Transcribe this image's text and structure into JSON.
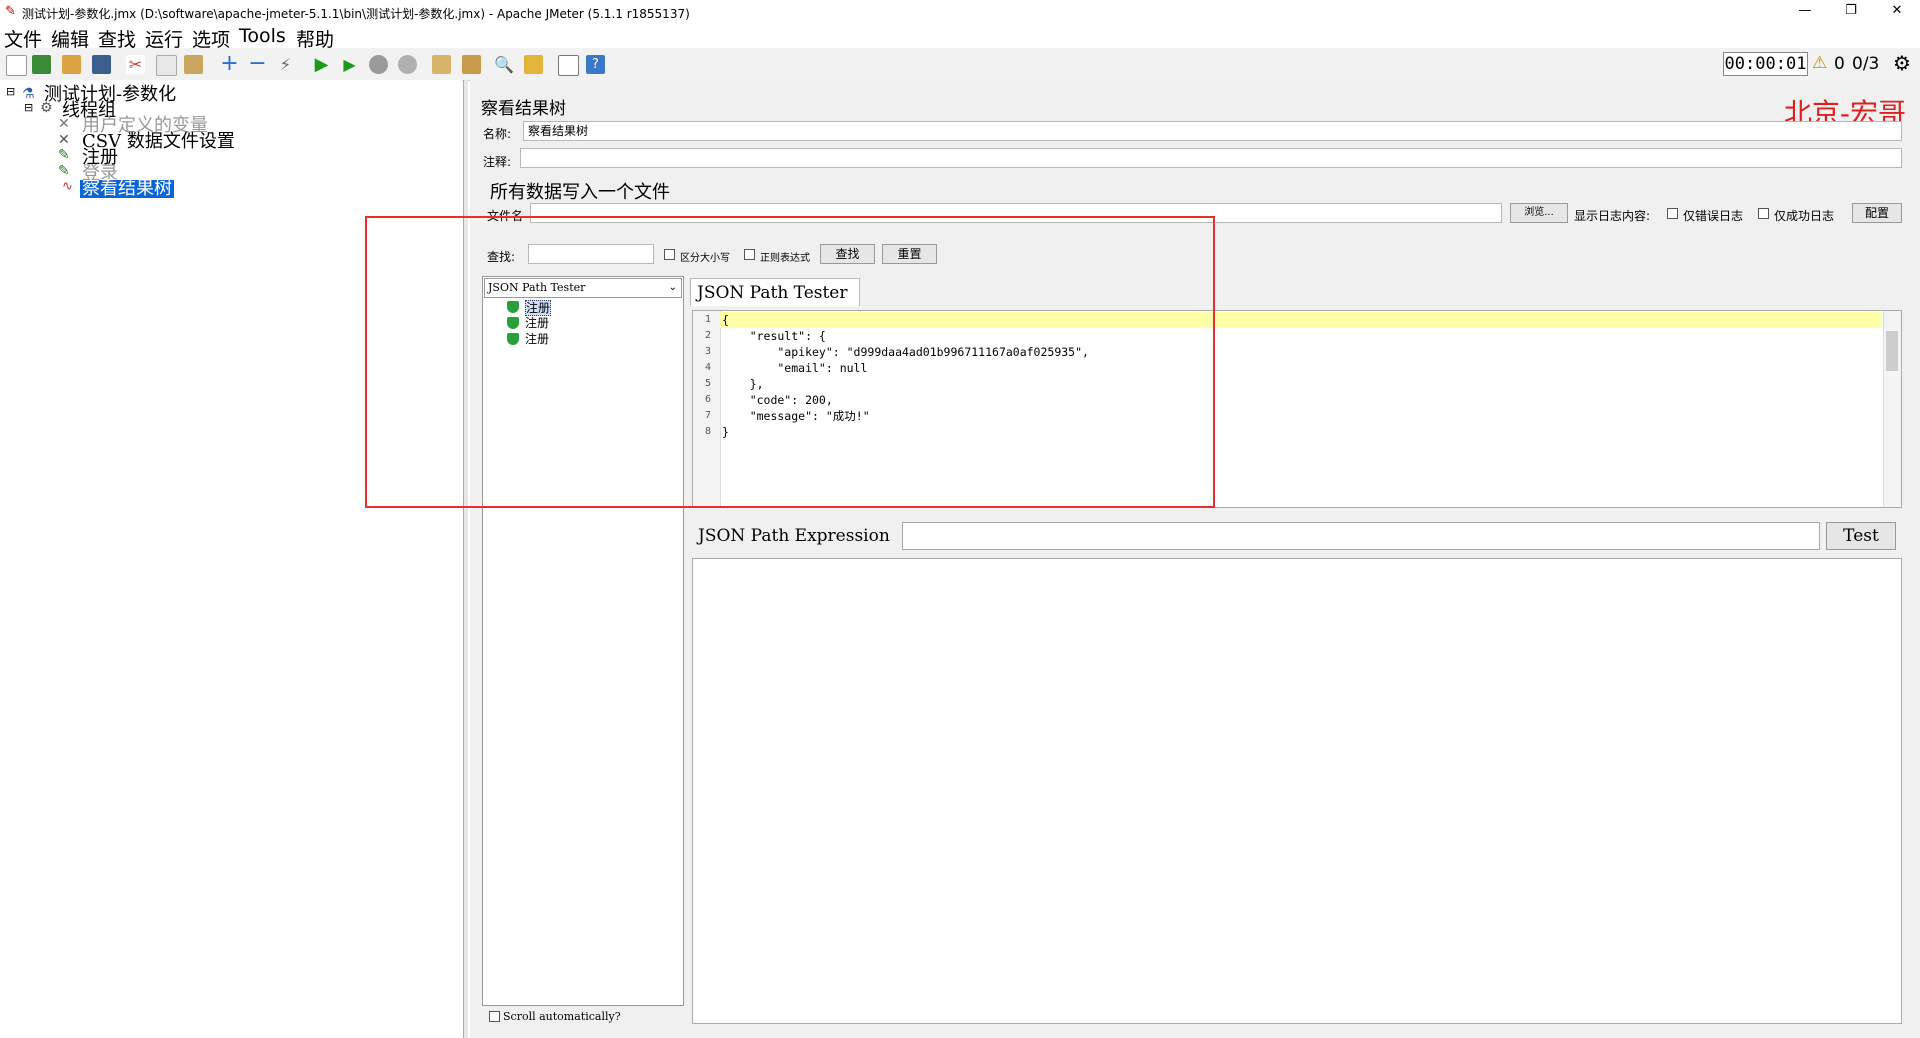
{
  "window": {
    "title": "测试计划-参数化.jmx (D:\\software\\apache-jmeter-5.1.1\\bin\\测试计划-参数化.jmx) - Apache JMeter (5.1.1 r1855137)",
    "min": "—",
    "max": "❐",
    "close": "✕"
  },
  "menu": [
    "文件",
    "编辑",
    "查找",
    "运行",
    "选项",
    "Tools",
    "帮助"
  ],
  "status": {
    "timer": "00:00:01",
    "warnings": "0",
    "threads": "0/3"
  },
  "tree": {
    "root": "测试计划-参数化",
    "thread_group": "线程组",
    "user_vars": "用户定义的变量",
    "csv": "CSV 数据文件设置",
    "register": "注册",
    "login": "登录",
    "result_tree": "察看结果树"
  },
  "panel": {
    "title": "察看结果树",
    "brand": "北京-宏哥",
    "name_label": "名称:",
    "name_value": "察看结果树",
    "comment_label": "注释:",
    "file_section": "所有数据写入一个文件",
    "filename_label": "文件名",
    "browse": "浏览...",
    "log_label": "显示日志内容:",
    "errors_only": "仅错误日志",
    "success_only": "仅成功日志",
    "config": "配置",
    "search_label": "查找:",
    "case_sensitive": "区分大小写",
    "regex": "正则表达式",
    "find": "查找",
    "reset": "重置"
  },
  "results": {
    "renderer": "JSON Path Tester",
    "items": [
      "注册",
      "注册",
      "注册"
    ],
    "scroll_auto": "Scroll automatically?"
  },
  "tester": {
    "tab": "JSON Path Tester",
    "lines": [
      "1",
      "2",
      "3",
      "4",
      "5",
      "6",
      "7",
      "8"
    ],
    "code": [
      "{",
      "    \"result\": {",
      "        \"apikey\": \"d999daa4ad01b996711167a0af025935\",",
      "        \"email\": null",
      "    },",
      "    \"code\": 200,",
      "    \"message\": \"成功!\"",
      "}"
    ],
    "expression_label": "JSON Path Expression",
    "test": "Test"
  },
  "colors": {
    "brand": "#e02020",
    "highlight": "#ffffa8",
    "annotation_box": "#e53030",
    "selection": "#0a64d8"
  }
}
